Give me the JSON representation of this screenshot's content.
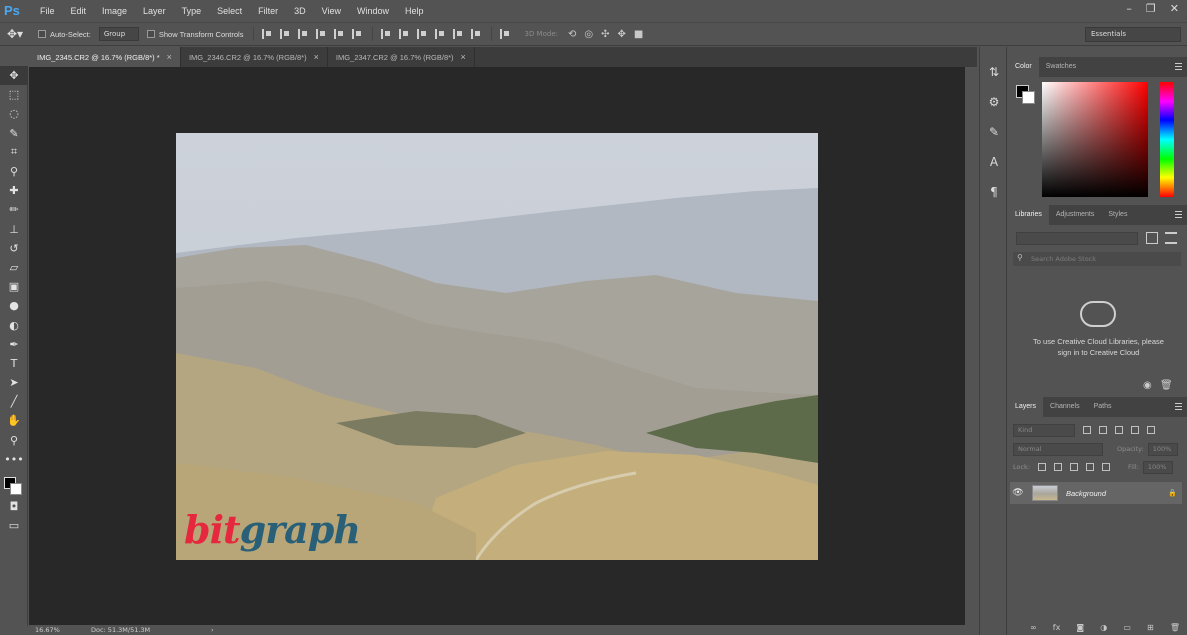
{
  "app": {
    "logo": "Ps"
  },
  "menu": [
    "File",
    "Edit",
    "Image",
    "Layer",
    "Type",
    "Select",
    "Filter",
    "3D",
    "View",
    "Window",
    "Help"
  ],
  "options_bar": {
    "auto_select_label": "Auto-Select:",
    "auto_select_value": "Group",
    "transform_label": "Show Transform Controls",
    "mode_label": "3D Mode:",
    "workspace": "Essentials"
  },
  "tabs": [
    {
      "label": "IMG_2345.CR2 @ 16.7% (RGB/8*) *",
      "active": true
    },
    {
      "label": "IMG_2346.CR2 @ 16.7% (RGB/8*)",
      "active": false
    },
    {
      "label": "IMG_2347.CR2 @ 16.7% (RGB/8*)",
      "active": false
    }
  ],
  "canvas": {
    "watermark_part1": "bit",
    "watermark_part2": "graph"
  },
  "status": {
    "zoom": "16.67%",
    "doc": "Doc: 51.3M/51.3M",
    "arrow": "›"
  },
  "panels": {
    "color_tabs": [
      "Color",
      "Swatches"
    ],
    "library_tabs": [
      "Libraries",
      "Adjustments",
      "Styles"
    ],
    "library_search_placeholder": "Search Adobe Stock",
    "library_message": "To use Creative Cloud Libraries, please sign in to Creative Cloud",
    "layers_tabs": [
      "Layers",
      "Channels",
      "Paths"
    ],
    "layers_filter": "Kind",
    "blend_mode": "Normal",
    "opacity_label": "Opacity:",
    "opacity_value": "100%",
    "lock_label": "Lock:",
    "fill_label": "Fill:",
    "fill_value": "100%",
    "layer_name": "Background"
  },
  "colors": {
    "foreground": "#000000",
    "background": "#ffffff",
    "watermark_red": "#e5283d",
    "watermark_blue": "#2a5f78"
  }
}
